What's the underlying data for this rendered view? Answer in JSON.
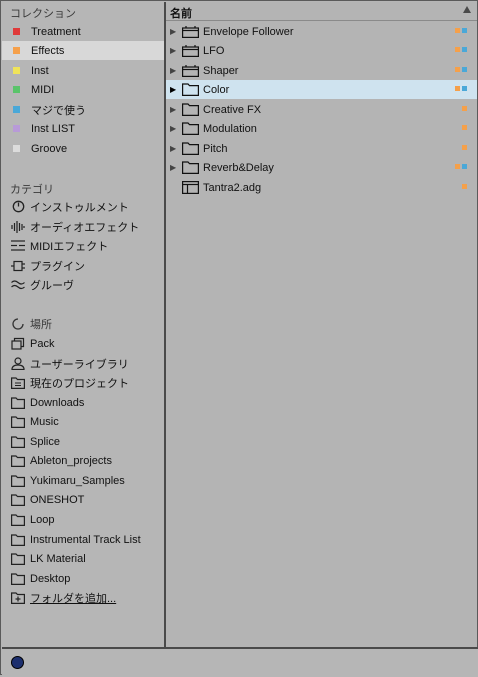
{
  "sidebar": {
    "collections_title": "コレクション",
    "collections": [
      {
        "label": "Treatment",
        "color": "#e03a3a"
      },
      {
        "label": "Effects",
        "color": "#f5a04a"
      },
      {
        "label": "Inst",
        "color": "#f0e45a"
      },
      {
        "label": "MIDI",
        "color": "#5ac46a"
      },
      {
        "label": "マジで使う",
        "color": "#4aa8d8"
      },
      {
        "label": "Inst LIST",
        "color": "#b89ad8"
      },
      {
        "label": "Groove",
        "color": "#dcdcdc"
      }
    ],
    "categories_title": "カテゴリ",
    "categories": [
      {
        "label": "インストゥルメント",
        "icon": "instrument-icon"
      },
      {
        "label": "オーディオエフェクト",
        "icon": "audio-effect-icon"
      },
      {
        "label": "MIDIエフェクト",
        "icon": "midi-effect-icon"
      },
      {
        "label": "プラグイン",
        "icon": "plugin-icon"
      },
      {
        "label": "グルーヴ",
        "icon": "groove-icon"
      }
    ],
    "places_title": "場所",
    "places": [
      {
        "label": "Pack",
        "icon": "pack-icon"
      },
      {
        "label": "ユーザーライブラリ",
        "icon": "user-library-icon"
      },
      {
        "label": "現在のプロジェクト",
        "icon": "current-project-icon"
      },
      {
        "label": "Downloads",
        "icon": "folder-icon"
      },
      {
        "label": "Music",
        "icon": "folder-icon"
      },
      {
        "label": "Splice",
        "icon": "folder-icon"
      },
      {
        "label": "Ableton_projects",
        "icon": "folder-icon"
      },
      {
        "label": "Yukimaru_Samples",
        "icon": "folder-icon"
      },
      {
        "label": "ONESHOT",
        "icon": "folder-icon"
      },
      {
        "label": "Loop",
        "icon": "folder-icon"
      },
      {
        "label": "Instrumental Track List",
        "icon": "folder-icon"
      },
      {
        "label": "LK Material",
        "icon": "folder-icon"
      },
      {
        "label": "Desktop",
        "icon": "folder-icon"
      }
    ],
    "add_folder": "フォルダを追加..."
  },
  "browser": {
    "column_name": "名前",
    "items": [
      {
        "label": "Envelope Follower",
        "icon": "rack-icon",
        "tags": [
          "#f5a04a",
          "#4aa8d8"
        ]
      },
      {
        "label": "LFO",
        "icon": "rack-icon",
        "tags": [
          "#f5a04a",
          "#4aa8d8"
        ]
      },
      {
        "label": "Shaper",
        "icon": "rack-icon",
        "tags": [
          "#f5a04a",
          "#4aa8d8"
        ]
      },
      {
        "label": "Color",
        "icon": "folder-icon",
        "tags": [
          "#f5a04a",
          "#4aa8d8"
        ]
      },
      {
        "label": "Creative FX",
        "icon": "folder-icon",
        "tags": [
          "#f5a04a"
        ]
      },
      {
        "label": "Modulation",
        "icon": "folder-icon",
        "tags": [
          "#f5a04a"
        ]
      },
      {
        "label": "Pitch",
        "icon": "folder-icon",
        "tags": [
          "#f5a04a"
        ]
      },
      {
        "label": "Reverb&Delay",
        "icon": "folder-icon",
        "tags": [
          "#f5a04a",
          "#4aa8d8"
        ]
      },
      {
        "label": "Tantra2.adg",
        "icon": "preset-file-icon",
        "tags": [
          "#f5a04a"
        ]
      }
    ]
  },
  "colors": {
    "selected_left": "#d8d8d8",
    "selected_right": "#cfe3ef"
  }
}
